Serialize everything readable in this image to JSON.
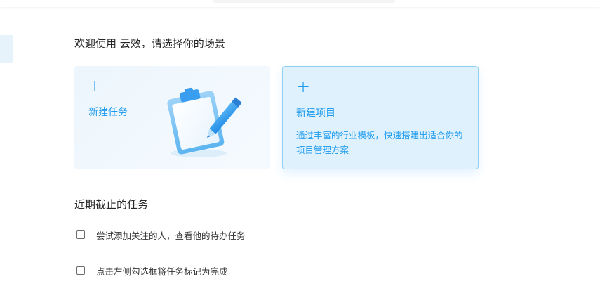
{
  "welcome": "欢迎使用 云效，请选择你的场景",
  "cards": {
    "task": {
      "plus": "+",
      "title": "新建任务"
    },
    "project": {
      "plus": "+",
      "title": "新建项目",
      "desc": "通过丰富的行业模板，快速搭建出适合你的项目管理方案"
    }
  },
  "recent": {
    "title": "近期截止的任务",
    "tasks": [
      {
        "text": "尝试添加关注的人，查看他的待办任务",
        "checked": false
      },
      {
        "text": "点击左侧勾选框将任务标记为完成",
        "checked": false
      }
    ]
  },
  "colors": {
    "accent": "#1b9aee",
    "project_card_bg": "#dff1fc",
    "project_card_border": "#8fd0f3",
    "task_card_bg": "#edf6fd"
  },
  "icons": {
    "plus": "plus-icon",
    "illustration": "clipboard-pencil-illustration"
  }
}
